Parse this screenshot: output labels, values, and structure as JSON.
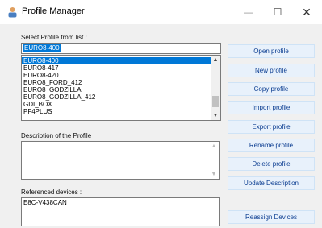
{
  "window": {
    "title": "Profile Manager",
    "minimize": "—",
    "maximize": "☐",
    "close": "✕"
  },
  "profile_select": {
    "label": "Select Profile from list :",
    "current_value": "EURO8-400",
    "items": [
      "EURO8-400",
      "EURO8-417",
      "EURO8-420",
      "EURO8_FORD_412",
      "EURO8_GODZILLA",
      "EURO8_GODZILLA_412",
      "GDI_BOX",
      "PF4PLUS"
    ],
    "selected_index": 0
  },
  "description": {
    "label": "Description of the Profile :",
    "value": ""
  },
  "devices": {
    "label": "Referenced devices :",
    "items": [
      "E8C-V438CAN"
    ]
  },
  "buttons": {
    "open": "Open profile",
    "new": "New profile",
    "copy": "Copy profile",
    "import": "Import profile",
    "export": "Export profile",
    "rename": "Rename profile",
    "delete": "Delete profile",
    "update_description": "Update Description",
    "reassign": "Reassign Devices"
  },
  "icons": {
    "scroll_up": "▲",
    "scroll_down": "▼"
  },
  "colors": {
    "selection": "#0078d7",
    "button_bg": "#e8f1fb",
    "button_text": "#0b3d91"
  }
}
